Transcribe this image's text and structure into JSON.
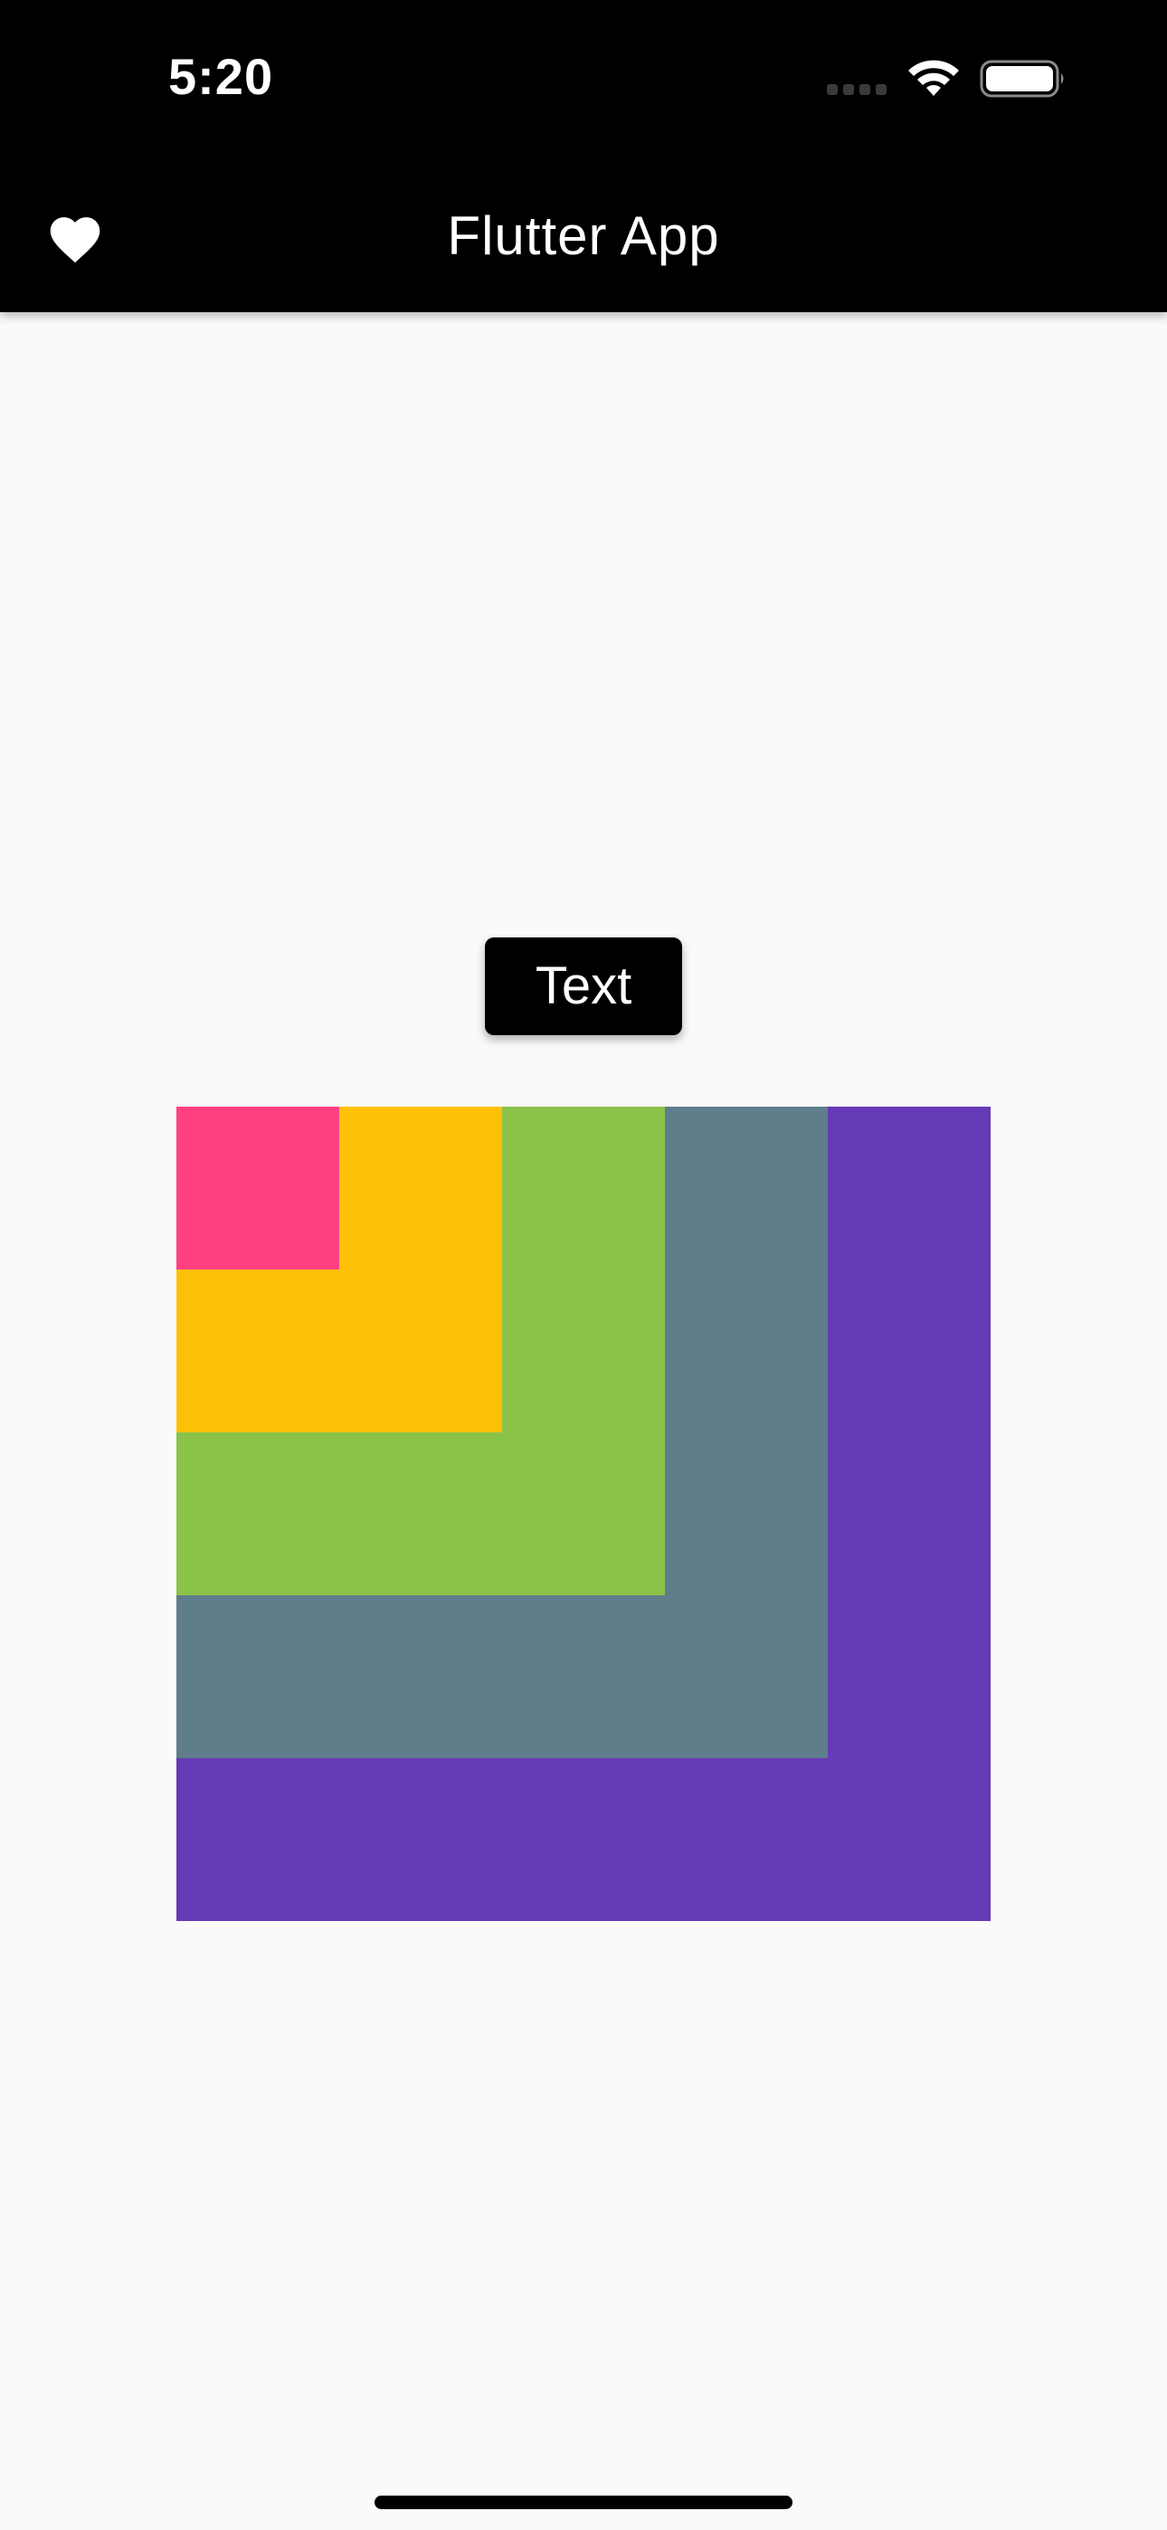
{
  "status_bar": {
    "time": "5:20"
  },
  "app_bar": {
    "title": "Flutter App",
    "leading_icon": "heart-icon"
  },
  "button": {
    "label": "Text"
  },
  "nested_boxes": {
    "colors": {
      "pink": "#ff4081",
      "amber": "#ffc107",
      "light_green": "#8bc34a",
      "blue_grey": "#607d8b",
      "deep_purple": "#673ab7"
    }
  },
  "colors": {
    "app_bar_background": "#000000",
    "page_background": "#fafafa",
    "button_background": "#000000",
    "text_on_dark": "#ffffff"
  }
}
